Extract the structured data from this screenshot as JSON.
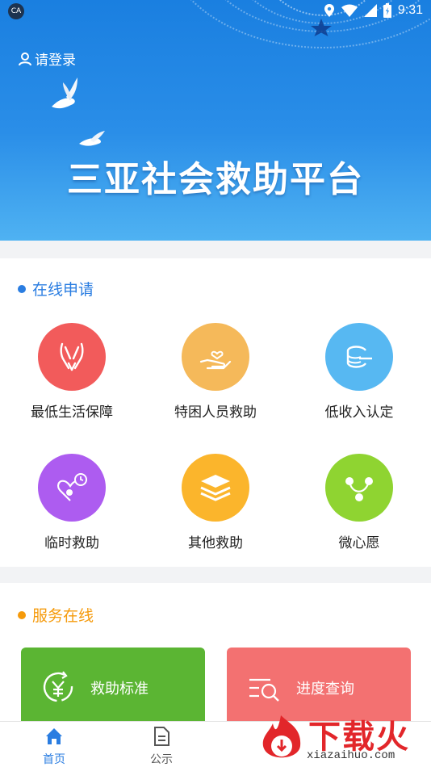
{
  "status_bar": {
    "app_badge": "CA",
    "time": "9:31"
  },
  "header": {
    "login_label": "请登录",
    "title": "三亚社会救助平台"
  },
  "online_apply": {
    "title": "在线申请",
    "accent": "#2a7de1",
    "items": [
      {
        "label": "最低生活保障",
        "icon": "hands-icon",
        "color": "#f25b5b"
      },
      {
        "label": "特困人员救助",
        "icon": "hand-heart-icon",
        "color": "#f5b95a"
      },
      {
        "label": "低收入认定",
        "icon": "coins-icon",
        "color": "#57b8f2"
      },
      {
        "label": "临时救助",
        "icon": "heart-clock-icon",
        "color": "#ad5cf0"
      },
      {
        "label": "其他救助",
        "icon": "layers-icon",
        "color": "#fbb52c"
      },
      {
        "label": "微心愿",
        "icon": "network-icon",
        "color": "#8fd431"
      }
    ]
  },
  "service_online": {
    "title": "服务在线",
    "accent": "#f59a0b",
    "cards": [
      {
        "label": "救助标准",
        "icon": "yen-refresh-icon",
        "color": "#5bb533"
      },
      {
        "label": "进度查询",
        "icon": "search-list-icon",
        "color": "#f37171"
      }
    ]
  },
  "bottom_nav": {
    "items": [
      {
        "label": "首页",
        "icon": "home-icon",
        "active": true
      },
      {
        "label": "公示",
        "icon": "document-icon",
        "active": false
      }
    ],
    "active_color": "#2a7de1",
    "inactive_color": "#555555"
  },
  "watermark": {
    "brand": "下载火",
    "url": "xiazaihuo.com"
  }
}
